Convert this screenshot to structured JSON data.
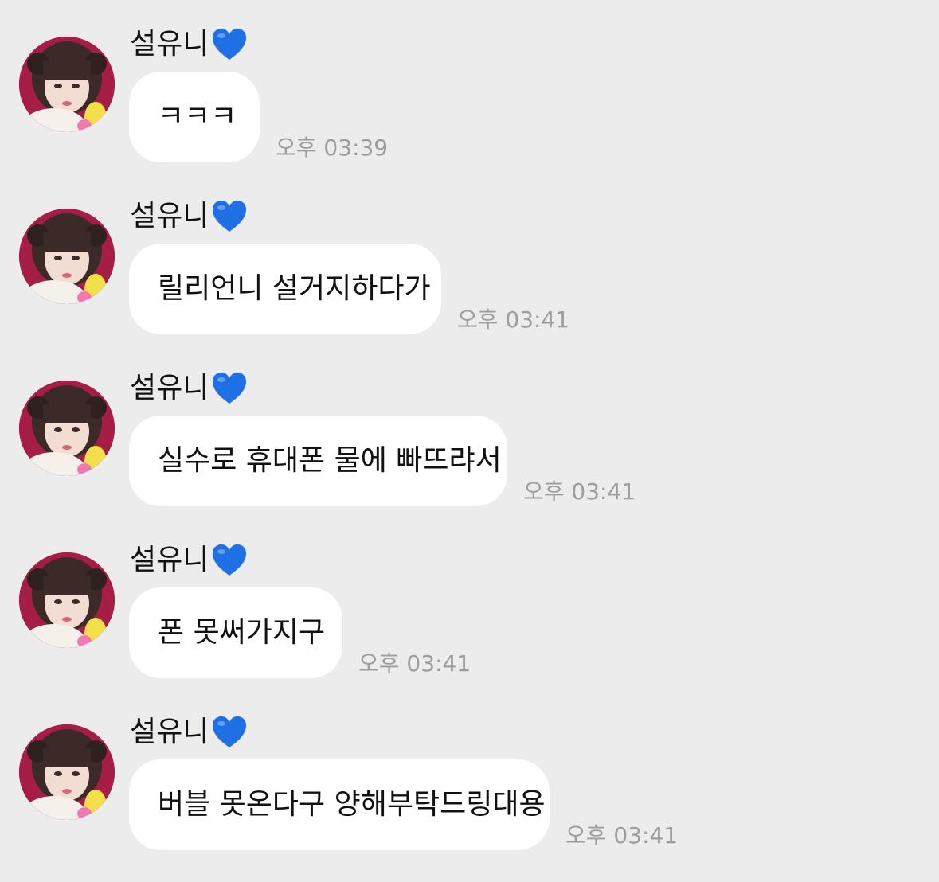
{
  "sender": {
    "name": "설유니",
    "heart_icon": "blue-heart-icon",
    "heart_color": "#1f6fe5",
    "avatar_icon": "profile-photo-avatar"
  },
  "colors": {
    "background": "#ececec",
    "bubble": "#ffffff",
    "timestamp": "#9d9d9d",
    "avatar_bg": "#a61e45"
  },
  "messages": [
    {
      "text": "ㅋㅋㅋ",
      "time": "오후 03:39"
    },
    {
      "text": "릴리언니 설거지하다가",
      "time": "오후 03:41"
    },
    {
      "text": "실수로 휴대폰 물에 빠뜨랴서",
      "time": "오후 03:41"
    },
    {
      "text": "폰 못써가지구",
      "time": "오후 03:41"
    },
    {
      "text": "버블 못온다구 양해부탁드링대용",
      "time": "오후 03:41"
    }
  ]
}
